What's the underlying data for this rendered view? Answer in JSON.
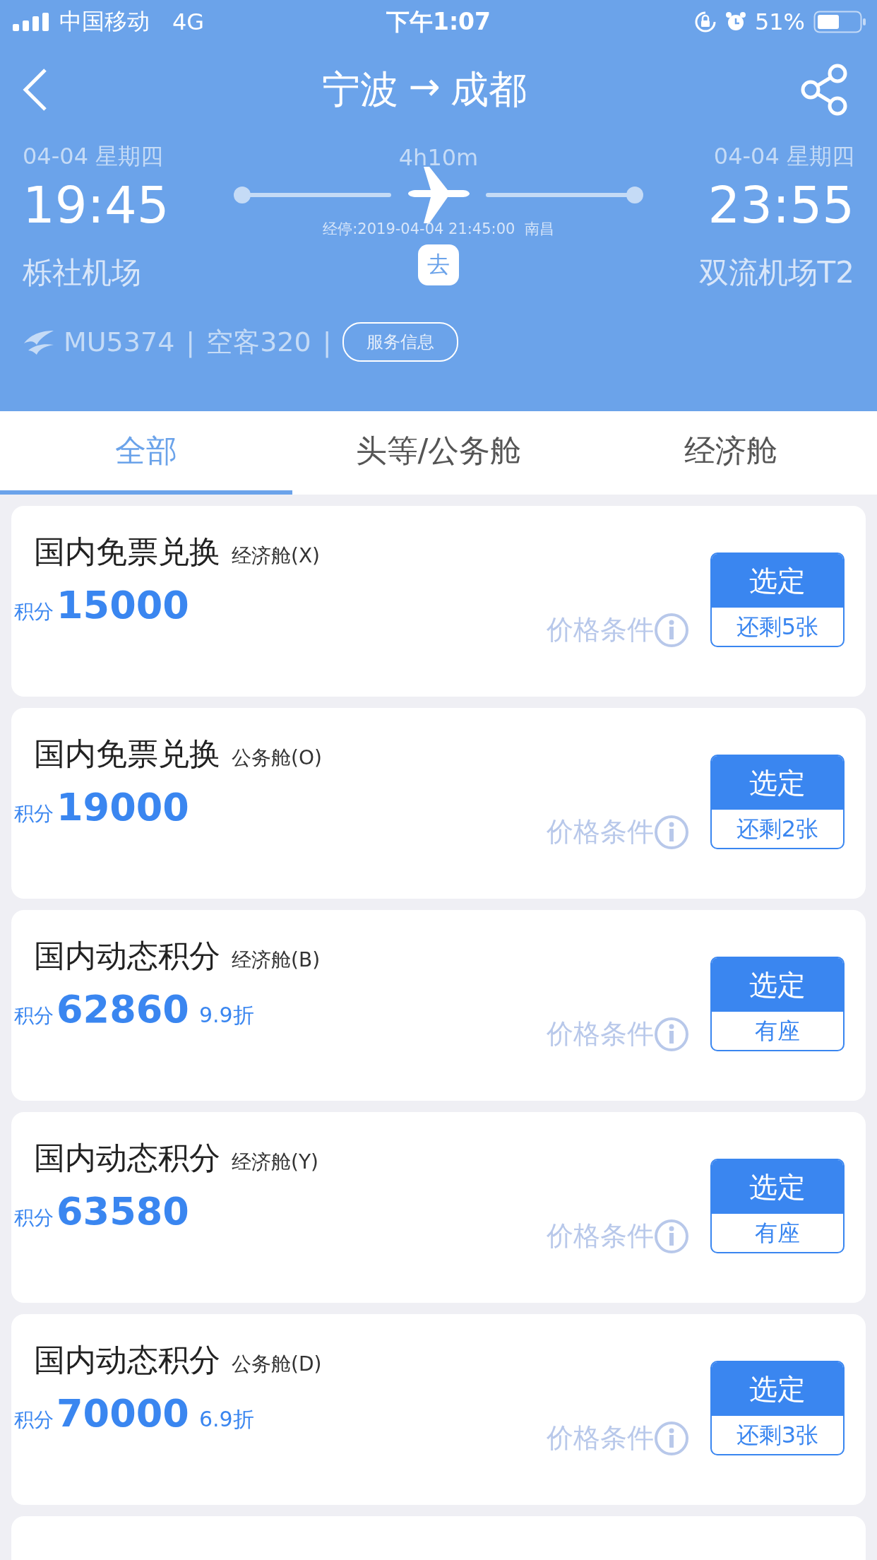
{
  "status_bar": {
    "carrier": "中国移动",
    "network": "4G",
    "time": "下午1:07",
    "battery": "51%"
  },
  "nav": {
    "title_from": "宁波",
    "arrow": "→",
    "title_to": "成都"
  },
  "flight": {
    "dep_date": "04-04 星期四",
    "arr_date": "04-04 星期四",
    "duration": "4h10m",
    "dep_time": "19:45",
    "arr_time": "23:55",
    "stopover": "经停:2019-04-04 21:45:00  南昌",
    "dep_airport": "栎社机场",
    "arr_airport": "双流机场T2",
    "direction": "去",
    "flight_no": "MU5374",
    "sep1": "|",
    "aircraft": "空客320",
    "sep2": "|",
    "service_button": "服务信息"
  },
  "tabs": [
    {
      "label": "全部",
      "selected": true
    },
    {
      "label": "头等/公务舱",
      "selected": false
    },
    {
      "label": "经济舱",
      "selected": false
    }
  ],
  "fares": [
    {
      "title": "国内免票兑换",
      "cabin": "经济舱(X)",
      "points_label": "积分",
      "points": "15000",
      "conditions": "价格条件",
      "select": "选定",
      "availability": "还剩5张"
    },
    {
      "title": "国内免票兑换",
      "cabin": "公务舱(O)",
      "points_label": "积分",
      "points": "19000",
      "conditions": "价格条件",
      "select": "选定",
      "availability": "还剩2张"
    },
    {
      "title": "国内动态积分",
      "cabin": "经济舱(B)",
      "points_label": "积分",
      "points": "62860",
      "discount": "9.9折",
      "conditions": "价格条件",
      "select": "选定",
      "availability": "有座"
    },
    {
      "title": "国内动态积分",
      "cabin": "经济舱(Y)",
      "points_label": "积分",
      "points": "63580",
      "conditions": "价格条件",
      "select": "选定",
      "availability": "有座"
    },
    {
      "title": "国内动态积分",
      "cabin": "公务舱(D)",
      "points_label": "积分",
      "points": "70000",
      "discount": "6.9折",
      "conditions": "价格条件",
      "select": "选定",
      "availability": "还剩3张"
    }
  ],
  "more_below": true
}
